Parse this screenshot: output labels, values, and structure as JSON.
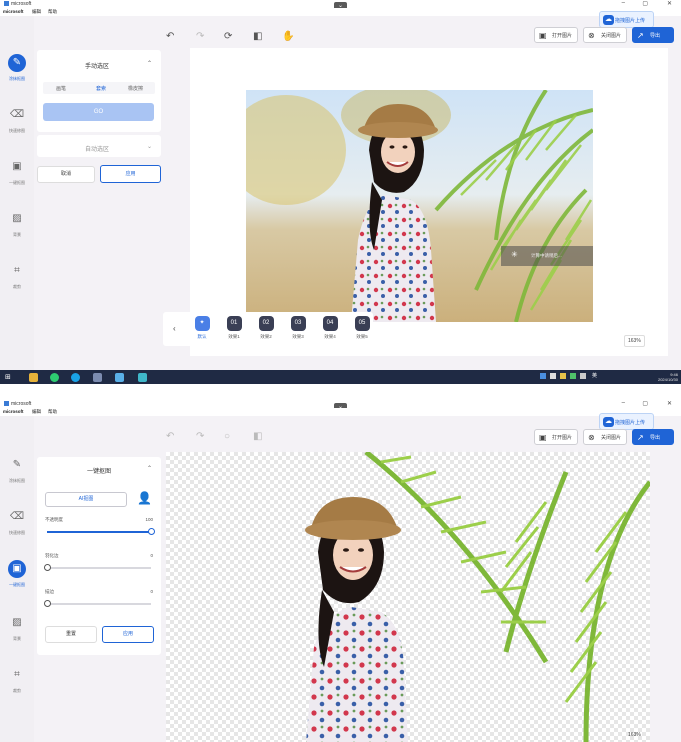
{
  "window": {
    "app_name": "microsoft",
    "menu": [
      "microsoft",
      "编辑",
      "帮助"
    ],
    "collapse_glyph": "⌄",
    "controls": [
      "–",
      "▢",
      "✕"
    ]
  },
  "header": {
    "upload_badge": "拖拽图片上传",
    "open_image": "打开图片",
    "close_image": "关闭图片",
    "export": "导出"
  },
  "sidebar": {
    "items": [
      {
        "label": "涂抹抠图",
        "icon": "brush-icon"
      },
      {
        "label": "快速修图",
        "icon": "eraser-icon"
      },
      {
        "label": "一键抠图",
        "icon": "cutout-icon"
      },
      {
        "label": "背景",
        "icon": "image-icon"
      },
      {
        "label": "裁剪",
        "icon": "crop-icon"
      }
    ]
  },
  "screen1": {
    "active_sidebar": 0,
    "manual_panel": {
      "title": "手动选区",
      "tabs": [
        "画笔",
        "套索",
        "橡皮擦"
      ],
      "active_tab": 1,
      "go_label": "GO"
    },
    "auto_panel": {
      "title": "自动选区"
    },
    "cancel_label": "取消",
    "apply_label": "应用",
    "effects": [
      {
        "badge": "✦",
        "label": "默认"
      },
      {
        "badge": "01",
        "label": "效果1"
      },
      {
        "badge": "02",
        "label": "效果2"
      },
      {
        "badge": "03",
        "label": "效果3"
      },
      {
        "badge": "04",
        "label": "效果4"
      },
      {
        "badge": "05",
        "label": "效果5"
      }
    ],
    "prev_arrow": "‹",
    "zoom": "163%",
    "loading_text": "计算中请稍后...",
    "taskbar_clock": {
      "time": "9:46",
      "date": "2024/10/30",
      "ime": "英"
    }
  },
  "screen2": {
    "active_sidebar": 2,
    "panel": {
      "title": "一键抠图",
      "cutout_button": "AI抠图",
      "sliders": [
        {
          "label": "不透明度",
          "value": "100",
          "fraction": 1.0
        },
        {
          "label": "羽化边",
          "value": "0",
          "fraction": 0.0
        },
        {
          "label": "描边",
          "value": "0",
          "fraction": 0.0
        }
      ],
      "reset_label": "重置",
      "apply_label": "应用"
    },
    "zoom": "163%"
  },
  "colors": {
    "accent": "#1f64d6",
    "sidebar_bg": "#f1eff3",
    "canvas_bg": "#f4f2f6",
    "taskbar": "#1f2a44"
  }
}
